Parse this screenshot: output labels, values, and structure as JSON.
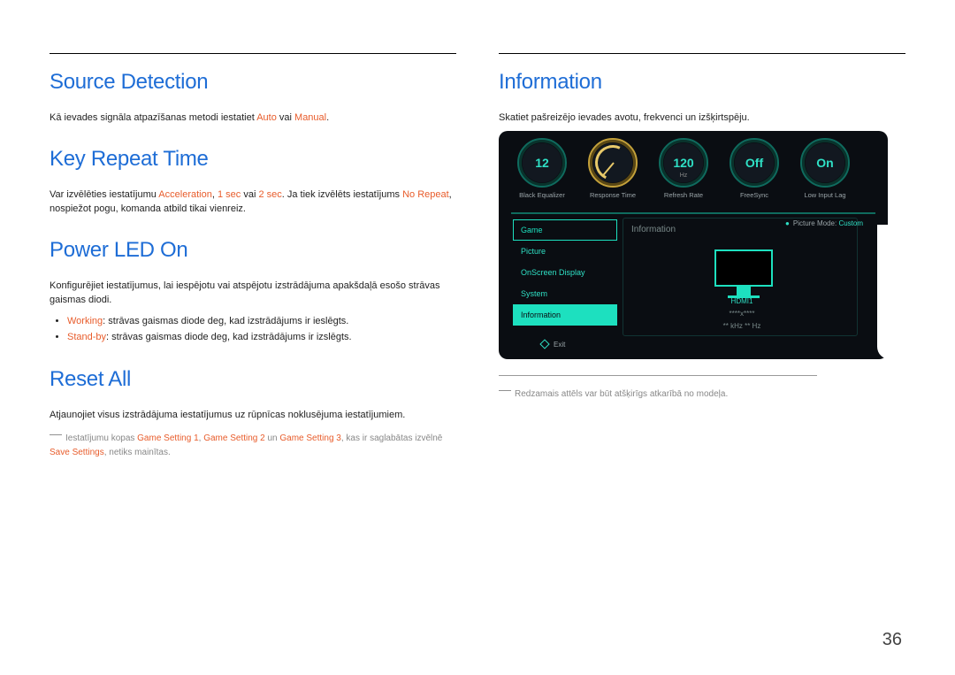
{
  "page_number": "36",
  "left": {
    "source_detection": {
      "heading": "Source Detection",
      "body_pre": "Kā ievades signāla atpazīšanas metodi iestatiet ",
      "auto": "Auto",
      "mid": " vai ",
      "manual": "Manual",
      "body_post": "."
    },
    "key_repeat": {
      "heading": "Key Repeat Time",
      "pre": "Var izvēlēties iestatījumu ",
      "accel": "Acceleration",
      "c1": ", ",
      "onesec": "1 sec",
      "c2": " vai ",
      "twosec": "2 sec",
      "mid": ". Ja tiek izvēlēts iestatījums ",
      "norepeat": "No Repeat",
      "post": ", nospiežot pogu, komanda atbild tikai vienreiz."
    },
    "power_led": {
      "heading": "Power LED On",
      "body": "Konfigurējiet iestatījumus, lai iespējotu vai atspējotu izstrādājuma apakšdaļā esošo strāvas gaismas diodi.",
      "working_label": "Working",
      "working_text": ": strāvas gaismas diode deg, kad izstrādājums ir ieslēgts.",
      "standby_label": "Stand-by",
      "standby_text": ": strāvas gaismas diode deg, kad izstrādājums ir izslēgts."
    },
    "reset_all": {
      "heading": "Reset All",
      "body": "Atjaunojiet visus izstrādājuma iestatījumus uz rūpnīcas noklusējuma iestatījumiem.",
      "fn_pre": "Iestatījumu kopas ",
      "gs1": "Game Setting 1",
      "c1": ", ",
      "gs2": "Game Setting 2",
      "c2": " un ",
      "gs3": "Game Setting 3",
      "mid": ", kas ir saglabātas izvēlnē ",
      "save": "Save Settings",
      "post": ", netiks mainītas."
    }
  },
  "right": {
    "information": {
      "heading": "Information",
      "body": "Skatiet pašreizējo ievades avotu, frekvenci un izšķirtspēju."
    },
    "osd": {
      "dials": [
        {
          "value": "12",
          "sub": "",
          "label": "Black Equalizer"
        },
        {
          "value": "",
          "sub": "",
          "label": "Response Time"
        },
        {
          "value": "120",
          "sub": "Hz",
          "label": "Refresh Rate"
        },
        {
          "value": "Off",
          "sub": "",
          "label": "FreeSync"
        },
        {
          "value": "On",
          "sub": "",
          "label": "Low Input Lag"
        }
      ],
      "menu": [
        "Game",
        "Picture",
        "OnScreen Display",
        "System",
        "Information"
      ],
      "panel_title": "Information",
      "picture_mode_label": "Picture Mode: ",
      "picture_mode_value": "Custom",
      "info_source": "HDMI1",
      "info_resolution": "****x****",
      "info_freq": "** kHz ** Hz",
      "exit": "Exit"
    },
    "fig_note": "Redzamais attēls var būt atšķirīgs atkarībā no modeļa."
  }
}
